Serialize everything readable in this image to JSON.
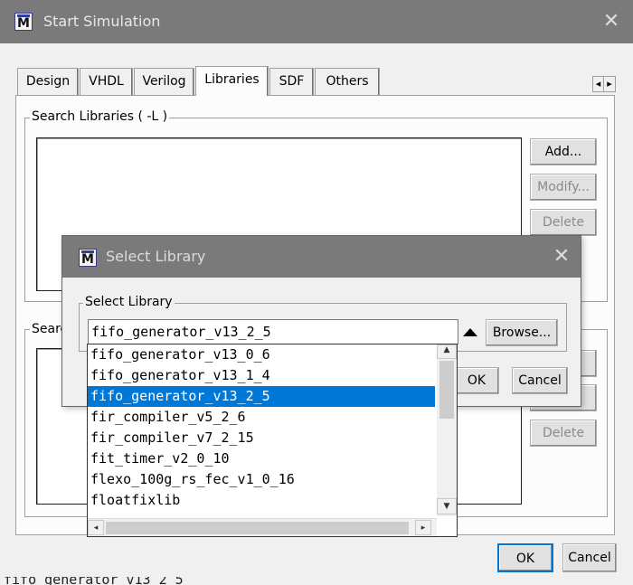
{
  "window": {
    "title": "Start Simulation",
    "close_glyph": "✕"
  },
  "tabs": [
    {
      "label": "Design"
    },
    {
      "label": "VHDL"
    },
    {
      "label": "Verilog"
    },
    {
      "label": "Libraries"
    },
    {
      "label": "SDF"
    },
    {
      "label": "Others"
    }
  ],
  "tab_scroll": {
    "left": "◂",
    "right": "▸"
  },
  "search_libraries": {
    "label": "Search Libraries ( -L )",
    "add": "Add...",
    "modify": "Modify...",
    "delete": "Delete"
  },
  "search_second": {
    "label_partial": "Searc",
    "delete": "Delete"
  },
  "footer": {
    "ok": "OK",
    "cancel": "Cancel"
  },
  "bottom_clip_text": "fifo_generator_v13_2_5",
  "select_library_dialog": {
    "title": "Select Library",
    "close_glyph": "✕",
    "group_label": "Select Library",
    "value": "fifo_generator_v13_2_5",
    "browse": "Browse...",
    "ok": "OK",
    "cancel": "Cancel",
    "options": [
      "fifo_generator_v13_0_6",
      "fifo_generator_v13_1_4",
      "fifo_generator_v13_2_5",
      "fir_compiler_v5_2_6",
      "fir_compiler_v7_2_15",
      "fit_timer_v2_0_10",
      "flexo_100g_rs_fec_v1_0_16",
      "floatfixlib"
    ],
    "selected_index": 2
  },
  "colors": {
    "selection": "#0078d7",
    "titlebar": "#7a7a7a"
  }
}
